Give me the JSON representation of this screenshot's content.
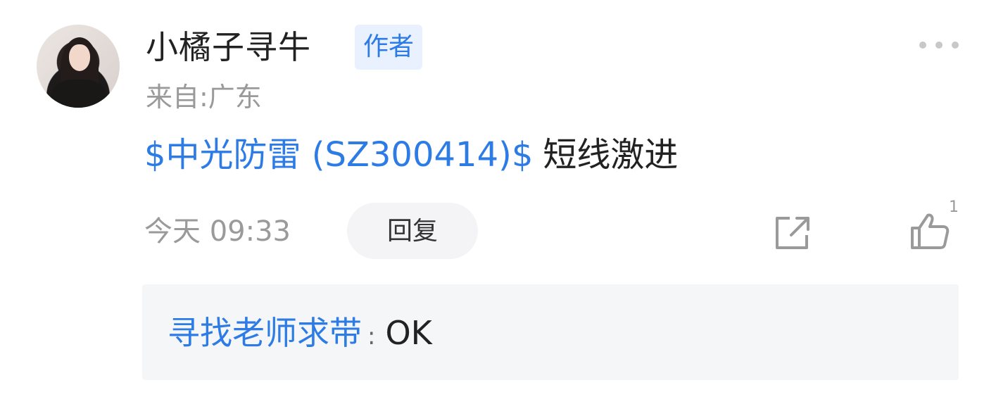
{
  "comment": {
    "author_name": "小橘子寻牛",
    "author_badge": "作者",
    "location": "来自:广东",
    "stock_link": "$中光防雷 (SZ300414)$",
    "text": "短线激进",
    "time": "今天 09:33",
    "reply_label": "回复",
    "like_count": "1",
    "icons": {
      "more": "more-horizontal-icon",
      "share": "share-icon",
      "like": "thumbs-up-icon"
    }
  },
  "reply": {
    "user": "寻找老师求带",
    "separator": ":",
    "text": "OK"
  },
  "colors": {
    "link_blue": "#2d7be5",
    "badge_bg": "#e8f1fd",
    "muted_gray": "#9a9a9a",
    "reply_bg": "#f5f6f8"
  }
}
